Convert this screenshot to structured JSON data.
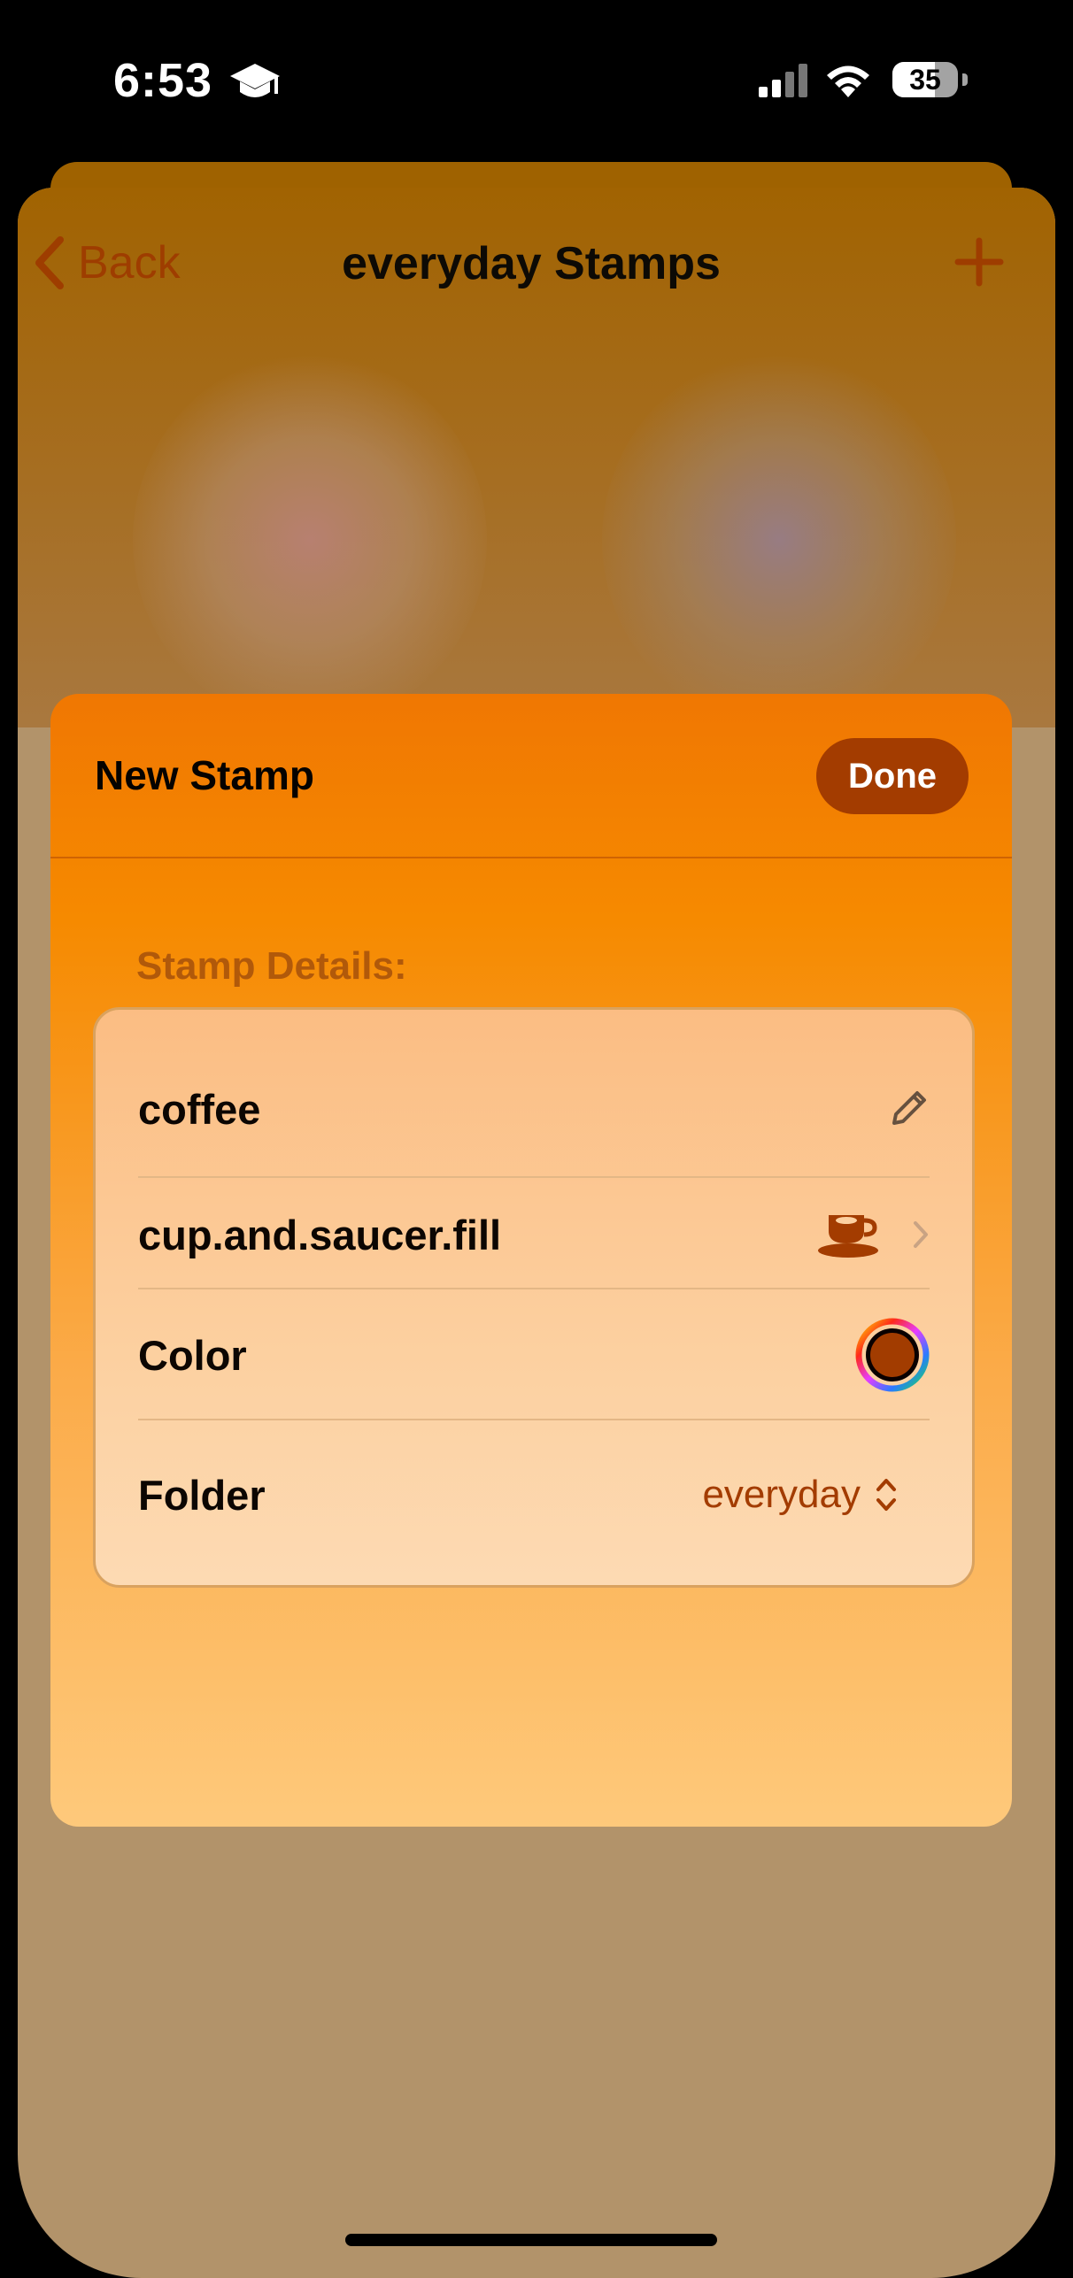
{
  "status_bar": {
    "time": "6:53",
    "battery": "35",
    "icons": [
      "graduation-cap-icon",
      "cellular-signal-icon",
      "wifi-icon",
      "battery-icon"
    ]
  },
  "nav": {
    "back_label": "Back",
    "title": "everyday Stamps",
    "add_icon": "plus-icon"
  },
  "sheet": {
    "title": "New Stamp",
    "done_label": "Done",
    "section_label": "Stamp Details:",
    "rows": {
      "name": {
        "value": "coffee",
        "icon": "pencil-icon"
      },
      "symbol": {
        "value": "cup.and.saucer.fill",
        "icon": "cup-and-saucer-icon",
        "chevron": "chevron-right-icon"
      },
      "color": {
        "label": "Color",
        "swatch": "#a23c00"
      },
      "folder": {
        "label": "Folder",
        "value": "everyday",
        "icon": "chevron-up-down-icon"
      }
    }
  },
  "colors": {
    "accent": "#a33c00",
    "sheet_top": "#f07702",
    "sheet_bottom": "#fec97b"
  }
}
